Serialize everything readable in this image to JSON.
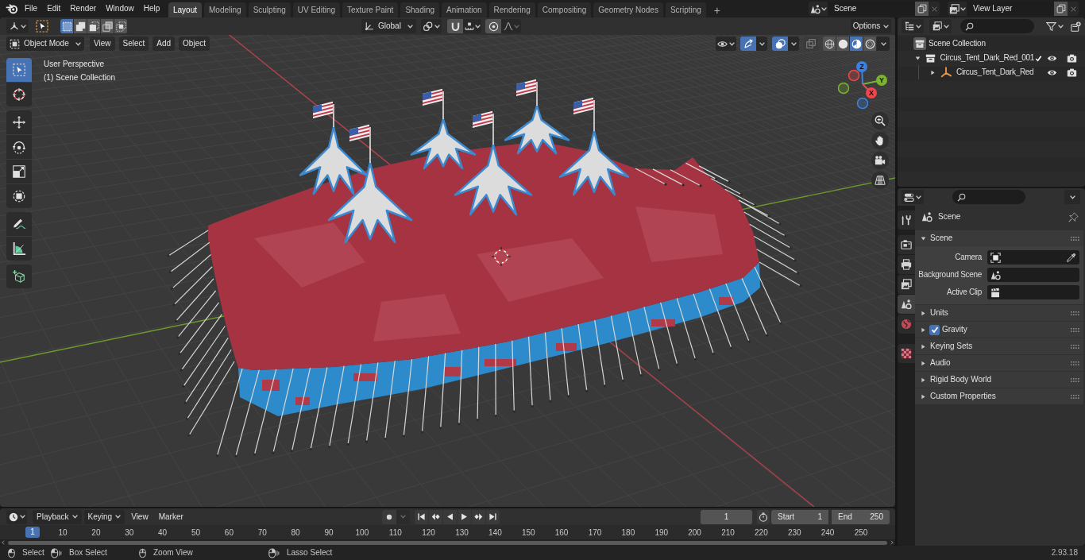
{
  "top_bar": {
    "menus": [
      "File",
      "Edit",
      "Render",
      "Window",
      "Help"
    ],
    "workspace_tabs": [
      {
        "label": "Layout",
        "selected": true
      },
      {
        "label": "Modeling",
        "selected": false
      },
      {
        "label": "Sculpting",
        "selected": false
      },
      {
        "label": "UV Editing",
        "selected": false
      },
      {
        "label": "Texture Paint",
        "selected": false
      },
      {
        "label": "Shading",
        "selected": false
      },
      {
        "label": "Animation",
        "selected": false
      },
      {
        "label": "Rendering",
        "selected": false
      },
      {
        "label": "Compositing",
        "selected": false
      },
      {
        "label": "Geometry Nodes",
        "selected": false
      },
      {
        "label": "Scripting",
        "selected": false
      }
    ],
    "add_tab": "+",
    "scene": "Scene",
    "view_layer": "View Layer"
  },
  "viewport": {
    "tool_header": {
      "select_modes": [
        {
          "kind": "set",
          "selected": true
        },
        {
          "kind": "extend",
          "selected": false
        },
        {
          "kind": "subtract",
          "selected": false
        },
        {
          "kind": "invert",
          "selected": false
        },
        {
          "kind": "intersect",
          "selected": false
        }
      ],
      "orientation": "Global",
      "snap_on": false,
      "proportional_editing_on": false,
      "options": "Options"
    },
    "header": {
      "mode": "Object Mode",
      "menus": [
        "View",
        "Select",
        "Add",
        "Object"
      ],
      "gizmos_on": true,
      "overlays_on": true,
      "xray_on": false,
      "shading": [
        {
          "kind": "wireframe",
          "selected": false
        },
        {
          "kind": "solid",
          "selected": false
        },
        {
          "kind": "material",
          "selected": true
        },
        {
          "kind": "rendered",
          "selected": false
        }
      ]
    },
    "toolbar": {
      "groups": [
        {
          "tools": [
            {
              "kind": "select_box",
              "selected": true
            },
            {
              "kind": "cursor",
              "selected": false
            }
          ]
        },
        {
          "tools": [
            {
              "kind": "move",
              "selected": false
            },
            {
              "kind": "rotate",
              "selected": false
            },
            {
              "kind": "scale",
              "selected": false
            },
            {
              "kind": "transform",
              "selected": false
            }
          ]
        },
        {
          "tools": [
            {
              "kind": "annotate",
              "selected": false
            },
            {
              "kind": "measure",
              "selected": false
            }
          ]
        },
        {
          "tools": [
            {
              "kind": "add_cube",
              "selected": false
            }
          ]
        }
      ]
    },
    "info": [
      "User Perspective",
      "(1) Scene Collection"
    ],
    "navigation_gizmo": {
      "axes": [
        "X",
        "Y",
        "Z"
      ]
    }
  },
  "outliner": {
    "tree": [
      {
        "label": "Scene Collection",
        "kind": "scene",
        "children": [
          {
            "label": "Circus_Tent_Dark_Red_001",
            "kind": "collection",
            "expanded": true,
            "checked": true,
            "children": [
              {
                "label": "Circus_Tent_Dark_Red",
                "kind": "empty",
                "expanded": false
              }
            ]
          }
        ]
      }
    ]
  },
  "properties": {
    "tab_groups": [
      {
        "tabs": [
          {
            "kind": "tool",
            "selected": false
          }
        ]
      },
      {
        "tabs": [
          {
            "kind": "render",
            "selected": false
          },
          {
            "kind": "output",
            "selected": false
          },
          {
            "kind": "view_layer",
            "selected": false
          },
          {
            "kind": "scene",
            "selected": true
          },
          {
            "kind": "world",
            "selected": false
          }
        ]
      },
      {
        "tabs": [
          {
            "kind": "texture",
            "selected": false
          }
        ]
      }
    ],
    "context": "Scene",
    "panels": [
      {
        "label": "Scene",
        "kind": "plain",
        "expanded": true,
        "fields": [
          {
            "label": "Camera",
            "kind": "camera"
          },
          {
            "label": "Background Scene",
            "kind": "scene"
          },
          {
            "label": "Active Clip",
            "kind": "clip"
          }
        ]
      },
      {
        "label": "Units",
        "kind": "plain",
        "expanded": false
      },
      {
        "label": "Gravity",
        "kind": "toggle",
        "checked": true,
        "expanded": false
      },
      {
        "label": "Keying Sets",
        "kind": "plain",
        "expanded": false
      },
      {
        "label": "Audio",
        "kind": "plain",
        "expanded": false
      },
      {
        "label": "Rigid Body World",
        "kind": "plain",
        "expanded": false
      },
      {
        "label": "Custom Properties",
        "kind": "plain",
        "expanded": false
      }
    ]
  },
  "timeline": {
    "menus": [
      {
        "label": "Playback",
        "kind": "dropdown"
      },
      {
        "label": "Keying",
        "kind": "dropdown"
      },
      {
        "label": "View",
        "kind": "menu"
      },
      {
        "label": "Marker",
        "kind": "menu"
      }
    ],
    "current_frame": "1",
    "start": {
      "label": "Start",
      "value": "1"
    },
    "end": {
      "label": "End",
      "value": "250"
    },
    "playhead": "1",
    "ruler": [
      "10",
      "20",
      "30",
      "40",
      "50",
      "60",
      "70",
      "80",
      "90",
      "100",
      "110",
      "120",
      "130",
      "140",
      "150",
      "160",
      "170",
      "180",
      "190",
      "200",
      "210",
      "220",
      "230",
      "240",
      "250"
    ]
  },
  "status_bar": {
    "hints": [
      {
        "label": "Select",
        "kind": "left_click"
      },
      {
        "label": "Box Select",
        "kind": "left_drag"
      },
      {
        "label": "Zoom View",
        "kind": "middle"
      },
      {
        "label": "Lasso Select",
        "kind": "right_drag"
      }
    ],
    "version": "2.93.18"
  }
}
